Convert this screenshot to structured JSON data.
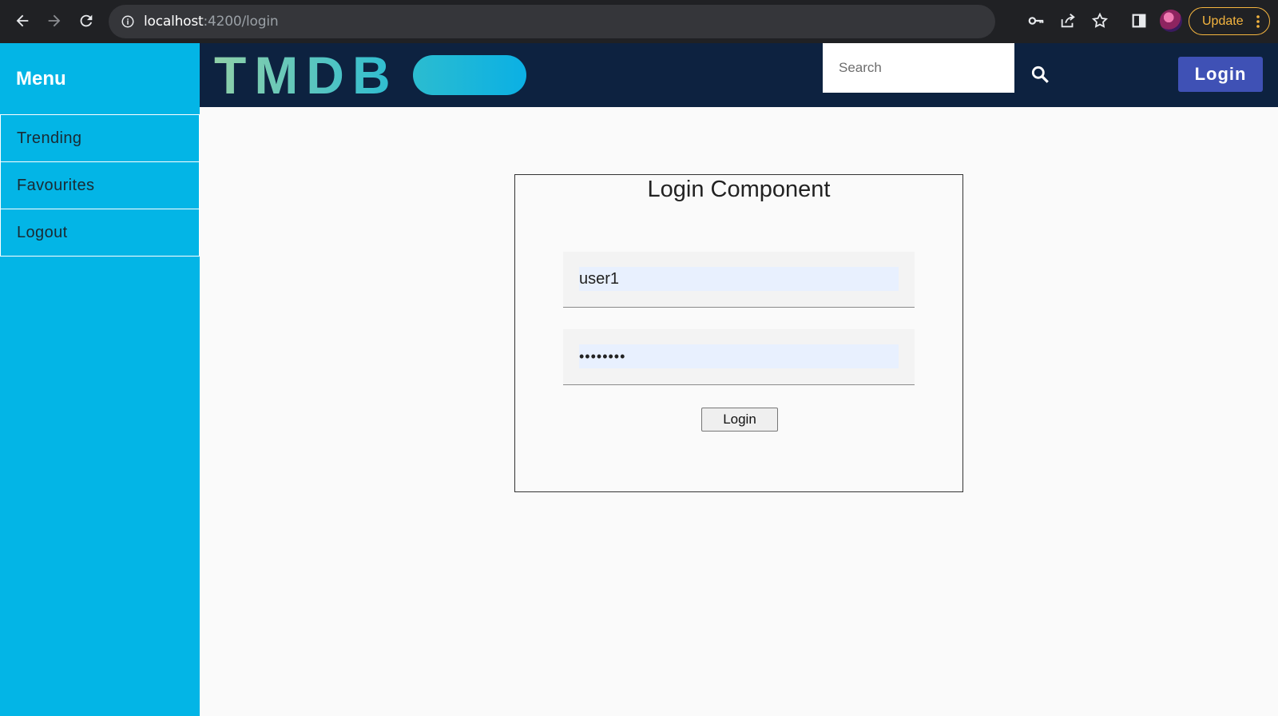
{
  "browser": {
    "url_host": "localhost",
    "url_path": ":4200/login",
    "update_label": "Update"
  },
  "sidebar": {
    "title": "Menu",
    "items": [
      {
        "label": "Trending"
      },
      {
        "label": "Favourites"
      },
      {
        "label": "Logout"
      }
    ]
  },
  "header": {
    "logo_text": "TMDB",
    "search_placeholder": "Search",
    "login_label": "Login"
  },
  "login_card": {
    "title": "Login Component",
    "username_value": "user1",
    "password_mask": "••••••••",
    "submit_label": "Login"
  },
  "colors": {
    "sidebar_bg": "#03b5e6",
    "header_bg": "#0d2240",
    "login_button_bg": "#3f51b5",
    "update_accent": "#f5b53f"
  }
}
